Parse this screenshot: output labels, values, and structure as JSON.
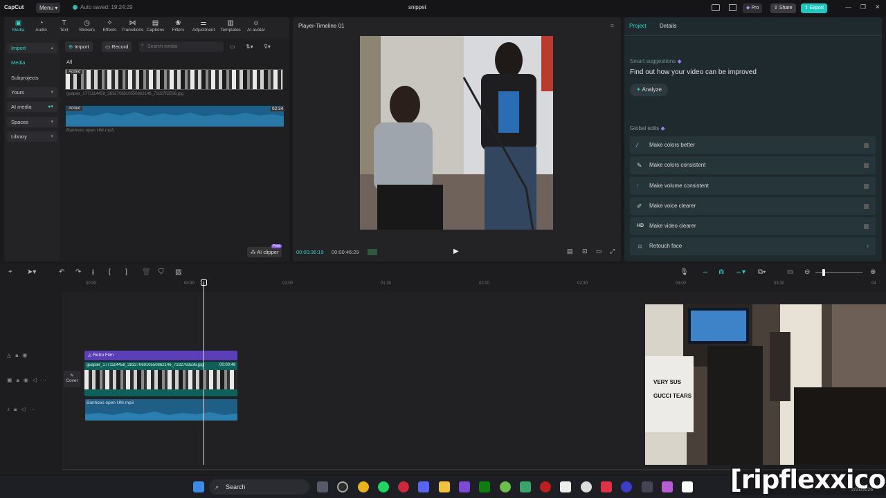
{
  "app": {
    "logo": "CapCut",
    "menu": "Menu",
    "autosave": "Auto saved: 19:24:29",
    "project_name": "snippet",
    "pro": "Pro",
    "share": "Share",
    "export": "Export"
  },
  "media_tools": [
    "Media",
    "Audio",
    "Text",
    "Stickers",
    "Effects",
    "Transitions",
    "Captions",
    "Filters",
    "Adjustment",
    "Templates",
    "AI avatar"
  ],
  "sidebar": {
    "items": [
      "Import",
      "Media",
      "Subprojects",
      "Yours",
      "AI media",
      "Spaces",
      "Library"
    ]
  },
  "media": {
    "import": "Import",
    "record": "Record",
    "search_placeholder": "Search media",
    "filter_all": "All",
    "added_label": "Added",
    "image_name": "guapier_1771114458_3832706910550862146_7182763536.jpg",
    "audio_name": "Banhoes open UM.mp3",
    "audio_duration": "02:34",
    "ai_clipper": "AI clipper",
    "free_badge": "Free"
  },
  "player": {
    "title": "Player-Timeline 01",
    "current_time": "00:00:36:19",
    "total_time": "00:00:46:29"
  },
  "details": {
    "tab_project": "Project",
    "tab_details": "Details",
    "smart_title": "Smart suggestions",
    "smart_desc": "Find out how your video can be improved",
    "analyze": "Analyze",
    "global_title": "Global edits",
    "global_items": [
      "Make colors better",
      "Make colors consistent",
      "Make volume consistent",
      "Make voice clearer",
      "Make video clearer",
      "Retouch face"
    ]
  },
  "timeline": {
    "ticks": [
      "00:00",
      "00:30",
      "01:00",
      "01:30",
      "02:00",
      "02:30",
      "03:00",
      "03:30",
      "04"
    ],
    "effect_clip": "Retro Film",
    "video_clip": "guapier_1771114458_3832706910550862146_7182763536.jpg",
    "video_clip_duration": "00:00:46",
    "audio_clip": "Banhoes open UM.mp3",
    "cover": "Cover"
  },
  "webcam": {
    "shirt_line1": "VERY SUS",
    "shirt_line2": "GUCCI TEARS"
  },
  "taskbar": {
    "search": "Search",
    "date": "2/21/2026"
  },
  "overlay": "[ripflexxico]"
}
